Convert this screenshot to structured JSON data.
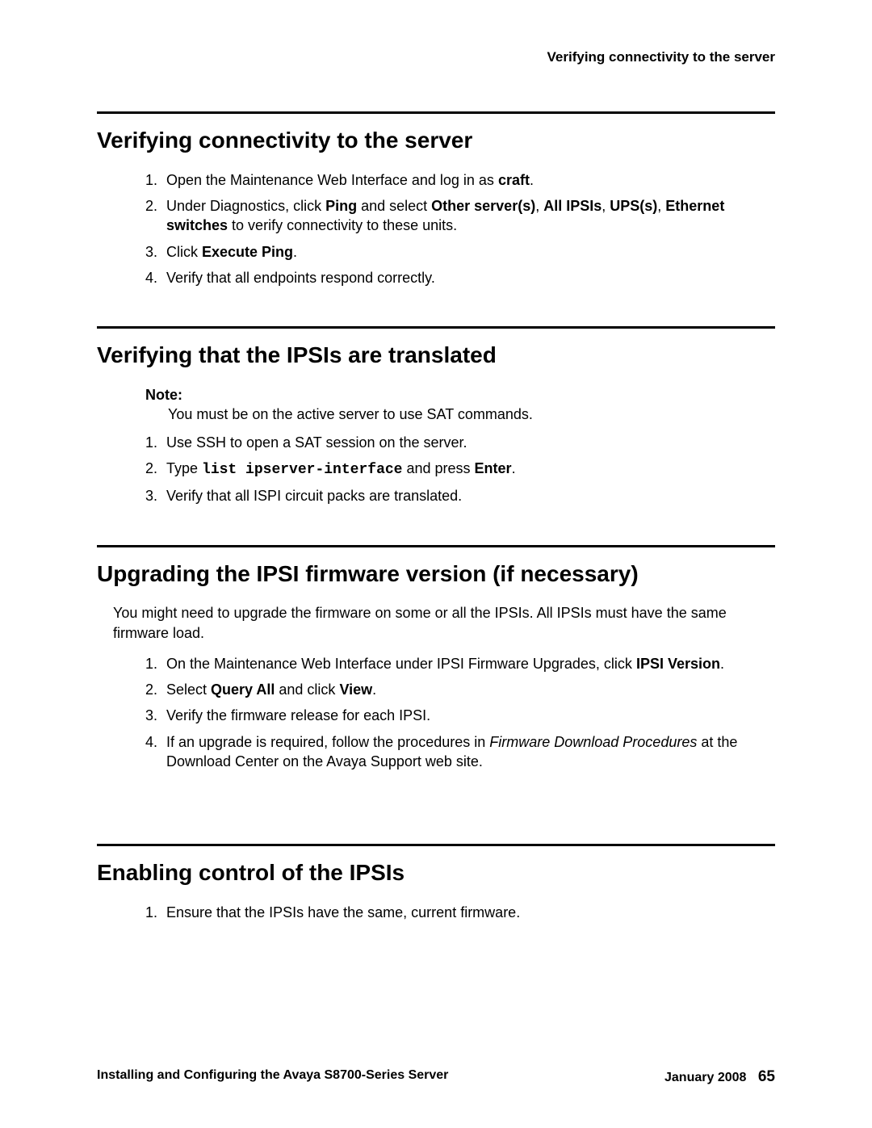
{
  "running_header": "Verifying connectivity to the server",
  "s1": {
    "heading": "Verifying connectivity to the server",
    "li1_a": "Open the Maintenance Web Interface and log in as ",
    "li1_b": "craft",
    "li1_c": ".",
    "li2_a": "Under Diagnostics, click ",
    "li2_b": "Ping",
    "li2_c": " and select ",
    "li2_d": "Other server(s)",
    "li2_e": ", ",
    "li2_f": "All IPSIs",
    "li2_g": ", ",
    "li2_h": "UPS(s)",
    "li2_i": ", ",
    "li2_j": "Ethernet switches",
    "li2_k": " to verify connectivity to these units.",
    "li3_a": "Click ",
    "li3_b": "Execute Ping",
    "li3_c": ".",
    "li4": "Verify that all endpoints respond correctly."
  },
  "s2": {
    "heading": "Verifying that the IPSIs are translated",
    "note_label": "Note:",
    "note_body": "You must be on the active server to use SAT commands.",
    "li1": "Use SSH to open a SAT session on the server.",
    "li2_a": "Type ",
    "li2_b": "list ipserver-interface",
    "li2_c": " and press ",
    "li2_d": "Enter",
    "li2_e": ".",
    "li3": "Verify that all ISPI circuit packs are translated."
  },
  "s3": {
    "heading": "Upgrading the IPSI firmware version (if necessary)",
    "intro": "You might need to upgrade the firmware on some or all the IPSIs. All IPSIs must have the same firmware load.",
    "li1_a": "On the Maintenance Web Interface under IPSI Firmware Upgrades, click ",
    "li1_b": "IPSI Version",
    "li1_c": ".",
    "li2_a": "Select ",
    "li2_b": "Query All",
    "li2_c": " and click ",
    "li2_d": "View",
    "li2_e": ".",
    "li3": "Verify the firmware release for each IPSI.",
    "li4_a": "If an upgrade is required, follow the procedures in ",
    "li4_b": "Firmware Download Procedures",
    "li4_c": " at the Download Center on the Avaya Support web site."
  },
  "s4": {
    "heading": "Enabling control of the IPSIs",
    "li1": "Ensure that the IPSIs have the same, current firmware."
  },
  "footer": {
    "left": "Installing and Configuring the Avaya S8700-Series Server",
    "date": "January 2008",
    "page": "65"
  }
}
